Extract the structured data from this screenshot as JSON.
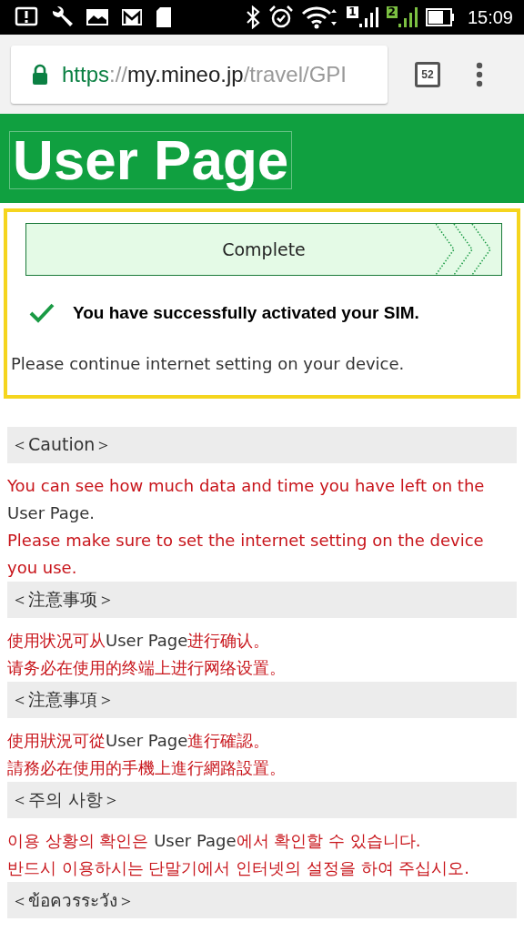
{
  "status_bar": {
    "time": "15:09",
    "sims": [
      {
        "label": "1",
        "active": false
      },
      {
        "label": "2",
        "active": true
      }
    ]
  },
  "browser": {
    "url": {
      "scheme": "https",
      "separator": "://",
      "host": "my.mineo.jp",
      "path": "/travel/GPI"
    },
    "tab_count": "52"
  },
  "header": {
    "title": "User Page"
  },
  "result": {
    "step": "Complete",
    "message": "You have successfully activated your SIM.",
    "note": "Please continue internet setting on your device."
  },
  "sections": [
    {
      "heading": "＜Caution＞",
      "lines": [
        [
          {
            "kind": "warning",
            "text": "You can see how much data and time you have left on the"
          }
        ],
        [
          {
            "kind": "normal",
            "text": "User Page."
          }
        ],
        [
          {
            "kind": "warning",
            "text": "Please make sure to set the internet setting on the device"
          }
        ],
        [
          {
            "kind": "warning",
            "text": "you use."
          }
        ]
      ]
    },
    {
      "heading": "＜注意事项＞",
      "lines": [
        [
          {
            "kind": "warning",
            "text": "使用状况可从"
          },
          {
            "kind": "normal",
            "text": "User Page"
          },
          {
            "kind": "warning",
            "text": "进行确认。"
          }
        ],
        [
          {
            "kind": "warning",
            "text": "请务必在使用的终端上进行网络设置。"
          }
        ]
      ]
    },
    {
      "heading": "＜注意事項＞",
      "lines": [
        [
          {
            "kind": "warning",
            "text": "使用狀況可從"
          },
          {
            "kind": "normal",
            "text": "User Page"
          },
          {
            "kind": "warning",
            "text": "進行確認。"
          }
        ],
        [
          {
            "kind": "warning",
            "text": "請務必在使用的手機上進行網路設置。"
          }
        ]
      ]
    },
    {
      "heading": "＜주의 사항＞",
      "lines": [
        [
          {
            "kind": "warning",
            "text": "이용 상황의 확인은 "
          },
          {
            "kind": "normal",
            "text": "User Page"
          },
          {
            "kind": "warning",
            "text": "에서 확인할 수 있습니다."
          }
        ],
        [
          {
            "kind": "warning",
            "text": "반드시 이용하시는 단말기에서 인터넷의 설정을 하여 주십시오."
          }
        ]
      ]
    },
    {
      "heading": "＜ข้อควรระวัง＞"
    }
  ]
}
